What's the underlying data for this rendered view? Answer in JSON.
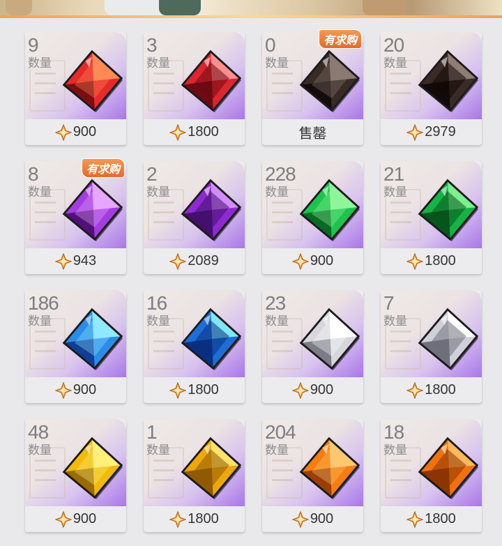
{
  "items": [
    {
      "quantity": "9",
      "label": "数量",
      "price": "900",
      "badge": "",
      "gem": {
        "light": "#ff8a55",
        "mid": "#e62a2a",
        "dark": "#7a0e12",
        "shape": "rough"
      }
    },
    {
      "quantity": "3",
      "label": "数量",
      "price": "1800",
      "badge": "",
      "gem": {
        "light": "#ff8f8f",
        "mid": "#d92630",
        "dark": "#6e0a12",
        "shape": "cut"
      }
    },
    {
      "quantity": "0",
      "label": "数量",
      "price": "售罄",
      "badge": "有求购",
      "gem": {
        "light": "#8a7a73",
        "mid": "#3a2a26",
        "dark": "#140c0a",
        "shape": "rough"
      }
    },
    {
      "quantity": "20",
      "label": "数量",
      "price": "2979",
      "badge": "",
      "gem": {
        "light": "#8f7d74",
        "mid": "#3b2b27",
        "dark": "#120a08",
        "shape": "cut"
      }
    },
    {
      "quantity": "8",
      "label": "数量",
      "price": "943",
      "badge": "有求购",
      "gem": {
        "light": "#e7a6ff",
        "mid": "#a23de0",
        "dark": "#52117a",
        "shape": "rough"
      }
    },
    {
      "quantity": "2",
      "label": "数量",
      "price": "2089",
      "badge": "",
      "gem": {
        "light": "#d28cff",
        "mid": "#8f2ad0",
        "dark": "#44106e",
        "shape": "cut"
      }
    },
    {
      "quantity": "228",
      "label": "数量",
      "price": "900",
      "badge": "",
      "gem": {
        "light": "#8ef59b",
        "mid": "#1fc24d",
        "dark": "#0a6a25",
        "shape": "rough"
      }
    },
    {
      "quantity": "21",
      "label": "数量",
      "price": "1800",
      "badge": "",
      "gem": {
        "light": "#7cf08d",
        "mid": "#18b146",
        "dark": "#07561e",
        "shape": "cut"
      }
    },
    {
      "quantity": "186",
      "label": "数量",
      "price": "900",
      "badge": "",
      "gem": {
        "light": "#8fe9ff",
        "mid": "#2b8ce8",
        "dark": "#103e94",
        "shape": "rough"
      }
    },
    {
      "quantity": "16",
      "label": "数量",
      "price": "1800",
      "badge": "",
      "gem": {
        "light": "#7ee8f6",
        "mid": "#1d6fd6",
        "dark": "#0b2f80",
        "shape": "cut"
      }
    },
    {
      "quantity": "23",
      "label": "数量",
      "price": "900",
      "badge": "",
      "gem": {
        "light": "#ffffff",
        "mid": "#d6d6dc",
        "dark": "#7c7c86",
        "shape": "rough"
      }
    },
    {
      "quantity": "7",
      "label": "数量",
      "price": "1800",
      "badge": "",
      "gem": {
        "light": "#ffffff",
        "mid": "#cfd0d8",
        "dark": "#70707c",
        "shape": "cut"
      }
    },
    {
      "quantity": "48",
      "label": "数量",
      "price": "900",
      "badge": "",
      "gem": {
        "light": "#fff07a",
        "mid": "#f2b90f",
        "dark": "#9a6a05",
        "shape": "rough"
      }
    },
    {
      "quantity": "1",
      "label": "数量",
      "price": "1800",
      "badge": "",
      "gem": {
        "light": "#ffe36a",
        "mid": "#eda70c",
        "dark": "#905a04",
        "shape": "cut"
      }
    },
    {
      "quantity": "204",
      "label": "数量",
      "price": "900",
      "badge": "",
      "gem": {
        "light": "#ffc870",
        "mid": "#f57d12",
        "dark": "#9a3e05",
        "shape": "rough"
      }
    },
    {
      "quantity": "18",
      "label": "数量",
      "price": "1800",
      "badge": "",
      "gem": {
        "light": "#ffb85c",
        "mid": "#ef720f",
        "dark": "#8c3504",
        "shape": "cut"
      }
    }
  ]
}
